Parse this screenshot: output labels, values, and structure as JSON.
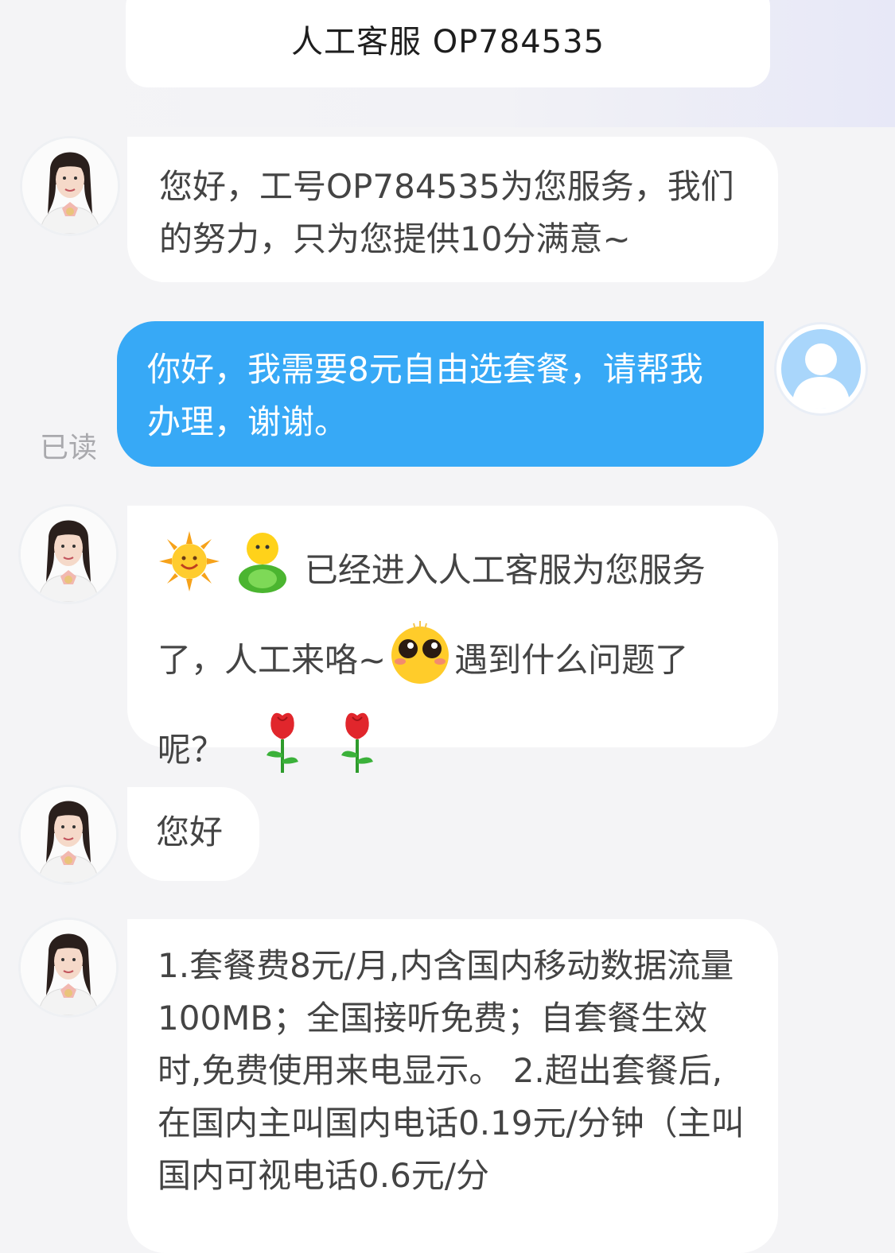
{
  "header": {
    "title": "人工客服 OP784535"
  },
  "messages": [
    {
      "sender": "agent",
      "text": "您好，工号OP784535为您服务，我们的努力，只为您提供10分满意~"
    },
    {
      "sender": "user",
      "text": "你好，我需要8元自由选套餐，请帮我办理，谢谢。",
      "status": "已读"
    },
    {
      "sender": "agent",
      "parts": [
        "已经进入人工客服为您服务了，人工来咯~",
        "遇到什么问题了呢？"
      ],
      "emoji": [
        "sun-emoji",
        "green-figure-emoji",
        "teary-face-emoji",
        "rose-emoji",
        "rose-emoji"
      ]
    },
    {
      "sender": "agent",
      "text": "您好"
    },
    {
      "sender": "agent",
      "text": "1.套餐费8元/月,内含国内移动数据流量100MB；全国接听免费；自套餐生效时,免费使用来电显示。 2.超出套餐后,在国内主叫国内电话0.19元/分钟（主叫国内可视电话0.6元/分"
    }
  ],
  "colors": {
    "user_bubble": "#37a9f6",
    "agent_bubble": "#ffffff",
    "background": "#f4f4f6"
  }
}
